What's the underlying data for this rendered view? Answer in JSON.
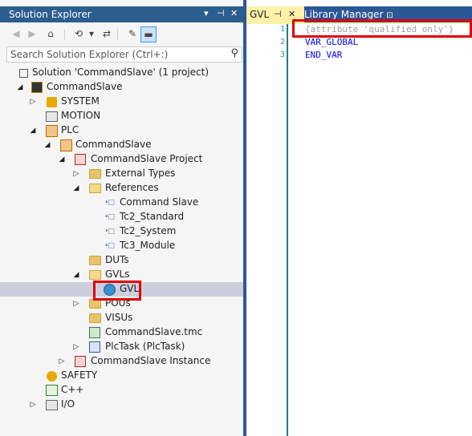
{
  "solution_explorer": {
    "title": "Solution Explorer",
    "title_controls": {
      "dropdown": "▾",
      "pin": "⊣",
      "close": "✕"
    },
    "search": {
      "placeholder": "Search Solution Explorer (Ctrl+:)"
    },
    "tree": {
      "solution": "Solution 'CommandSlave' (1 project)",
      "project": "CommandSlave",
      "system": "SYSTEM",
      "motion": "MOTION",
      "plc": "PLC",
      "plc_project": "CommandSlave",
      "plc_subproject": "CommandSlave Project",
      "external_types": "External Types",
      "references": "References",
      "ref1": "Command Slave",
      "ref2": "Tc2_Standard",
      "ref3": "Tc2_System",
      "ref4": "Tc3_Module",
      "duts": "DUTs",
      "gvls": "GVLs",
      "gvl": "GVL",
      "pous": "POUs",
      "visus": "VISUs",
      "tmc": "CommandSlave.tmc",
      "plctask": "PlcTask (PlcTask)",
      "instance": "CommandSlave Instance",
      "safety": "SAFETY",
      "cpp": "C++",
      "io": "I/O"
    }
  },
  "editor": {
    "tabs": {
      "active": "GVL",
      "active_pin": "⊣",
      "active_close": "✕",
      "other": "Library Manager",
      "other_icon": "⊡"
    },
    "lines": [
      {
        "num": "1",
        "text": "{attribute 'qualified_only'}"
      },
      {
        "num": "2",
        "text": "VAR_GLOBAL"
      },
      {
        "num": "3",
        "text": "END_VAR"
      }
    ]
  },
  "colors": {
    "highlight": "#e00000",
    "keyword": "#0000ff",
    "attribute": "#a0a0a0",
    "tab_active": "#fff1a8"
  }
}
